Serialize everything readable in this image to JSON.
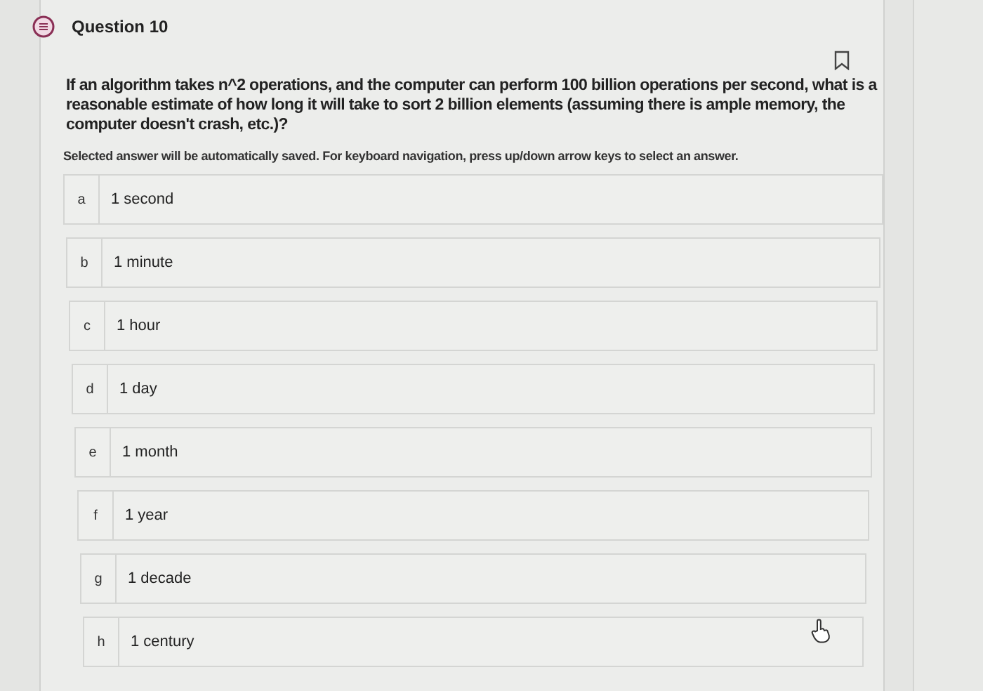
{
  "question": {
    "title": "Question 10",
    "text": "If an algorithm takes n^2 operations, and the computer can perform 100 billion operations per second, what is a reasonable estimate of how long it will take to sort 2 billion elements (assuming there is ample memory, the computer doesn't crash, etc.)?",
    "instruction": "Selected answer will be automatically saved. For keyboard navigation, press up/down arrow keys to select an answer."
  },
  "options": [
    {
      "letter": "a",
      "label": "1 second",
      "selected": false
    },
    {
      "letter": "b",
      "label": "1 minute",
      "selected": false
    },
    {
      "letter": "c",
      "label": "1 hour",
      "selected": false
    },
    {
      "letter": "d",
      "label": "1 day",
      "selected": false
    },
    {
      "letter": "e",
      "label": "1 month",
      "selected": false
    },
    {
      "letter": "f",
      "label": "1 year",
      "selected": false
    },
    {
      "letter": "g",
      "label": "1 decade",
      "selected": false
    },
    {
      "letter": "h",
      "label": "1 century",
      "selected": false
    }
  ]
}
